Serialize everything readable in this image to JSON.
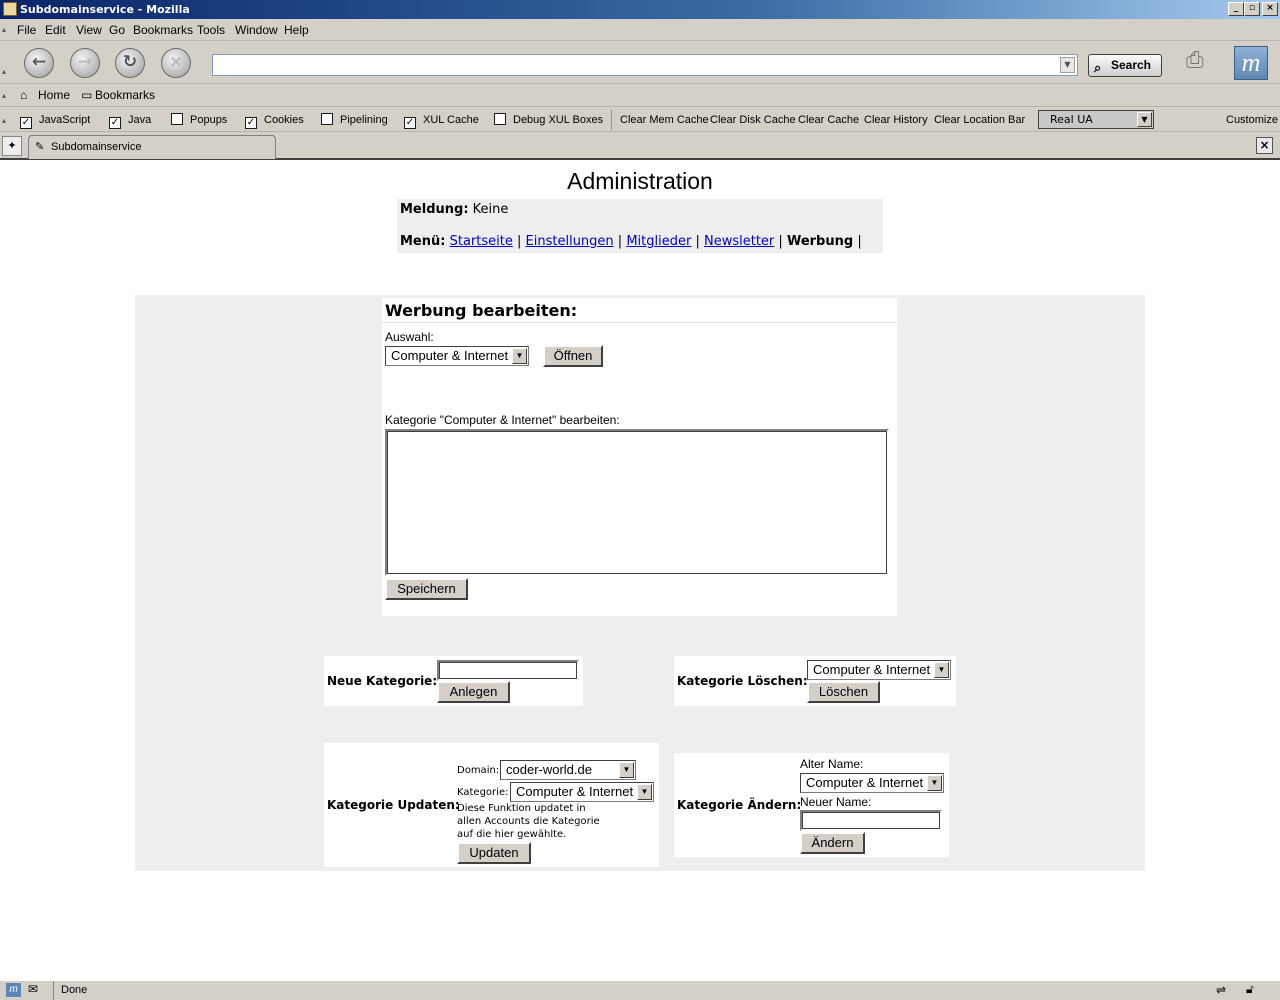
{
  "window": {
    "title": "Subdomainservice - Mozilla",
    "minimize": "_",
    "maximize": "▫",
    "close": "×"
  },
  "menu": [
    "File",
    "Edit",
    "View",
    "Go",
    "Bookmarks",
    "Tools",
    "Window",
    "Help"
  ],
  "nav": {
    "url": "",
    "search_label": "Search"
  },
  "personal_toolbar": {
    "home": "Home",
    "bookmarks": "Bookmarks"
  },
  "prefbar": {
    "checkboxes": [
      {
        "label": "JavaScript",
        "checked": true
      },
      {
        "label": "Java",
        "checked": true
      },
      {
        "label": "Popups",
        "checked": false
      },
      {
        "label": "Cookies",
        "checked": true
      },
      {
        "label": "Pipelining",
        "checked": false
      },
      {
        "label": "XUL Cache",
        "checked": true
      },
      {
        "label": "Debug XUL Boxes",
        "checked": false
      }
    ],
    "buttons": [
      "Clear Mem Cache",
      "Clear Disk Cache",
      "Clear Cache",
      "Clear History",
      "Clear Location Bar"
    ],
    "ua_select": "Real UA",
    "customize": "Customize"
  },
  "tab": {
    "label": "Subdomainservice"
  },
  "page": {
    "title": "Administration",
    "message_label": "Meldung:",
    "message_value": "Keine",
    "menu_label": "Menü:",
    "nav_links": [
      "Startseite",
      "Einstellungen",
      "Mitglieder",
      "Newsletter"
    ],
    "nav_current": "Werbung",
    "sep": "|"
  },
  "edit_ads": {
    "heading": "Werbung bearbeiten:",
    "select_label": "Auswahl:",
    "selected_category": "Computer & Internet",
    "open_button": "Öffnen",
    "textarea_label": "Kategorie \"Computer & Internet\" bearbeiten:",
    "textarea_value": "",
    "save_button": "Speichern"
  },
  "new_category": {
    "label": "Neue Kategorie:",
    "input_value": "",
    "button": "Anlegen"
  },
  "delete_category": {
    "label": "Kategorie Löschen:",
    "selected": "Computer & Internet",
    "button": "Löschen"
  },
  "update_category": {
    "label": "Kategorie Updaten:",
    "domain_label": "Domain:",
    "domain_value": "coder-world.de",
    "category_label": "Kategorie:",
    "category_value": "Computer & Internet",
    "note_line1": "Diese Funktion updatet in",
    "note_line2": "allen Accounts die Kategorie",
    "note_line3": "auf die hier gewählte.",
    "button": "Updaten"
  },
  "rename_category": {
    "label": "Kategorie Ändern:",
    "old_label": "Alter Name:",
    "old_value": "Computer & Internet",
    "new_label": "Neuer Name:",
    "new_value": "",
    "button": "Ändern"
  },
  "status": {
    "text": "Done"
  }
}
